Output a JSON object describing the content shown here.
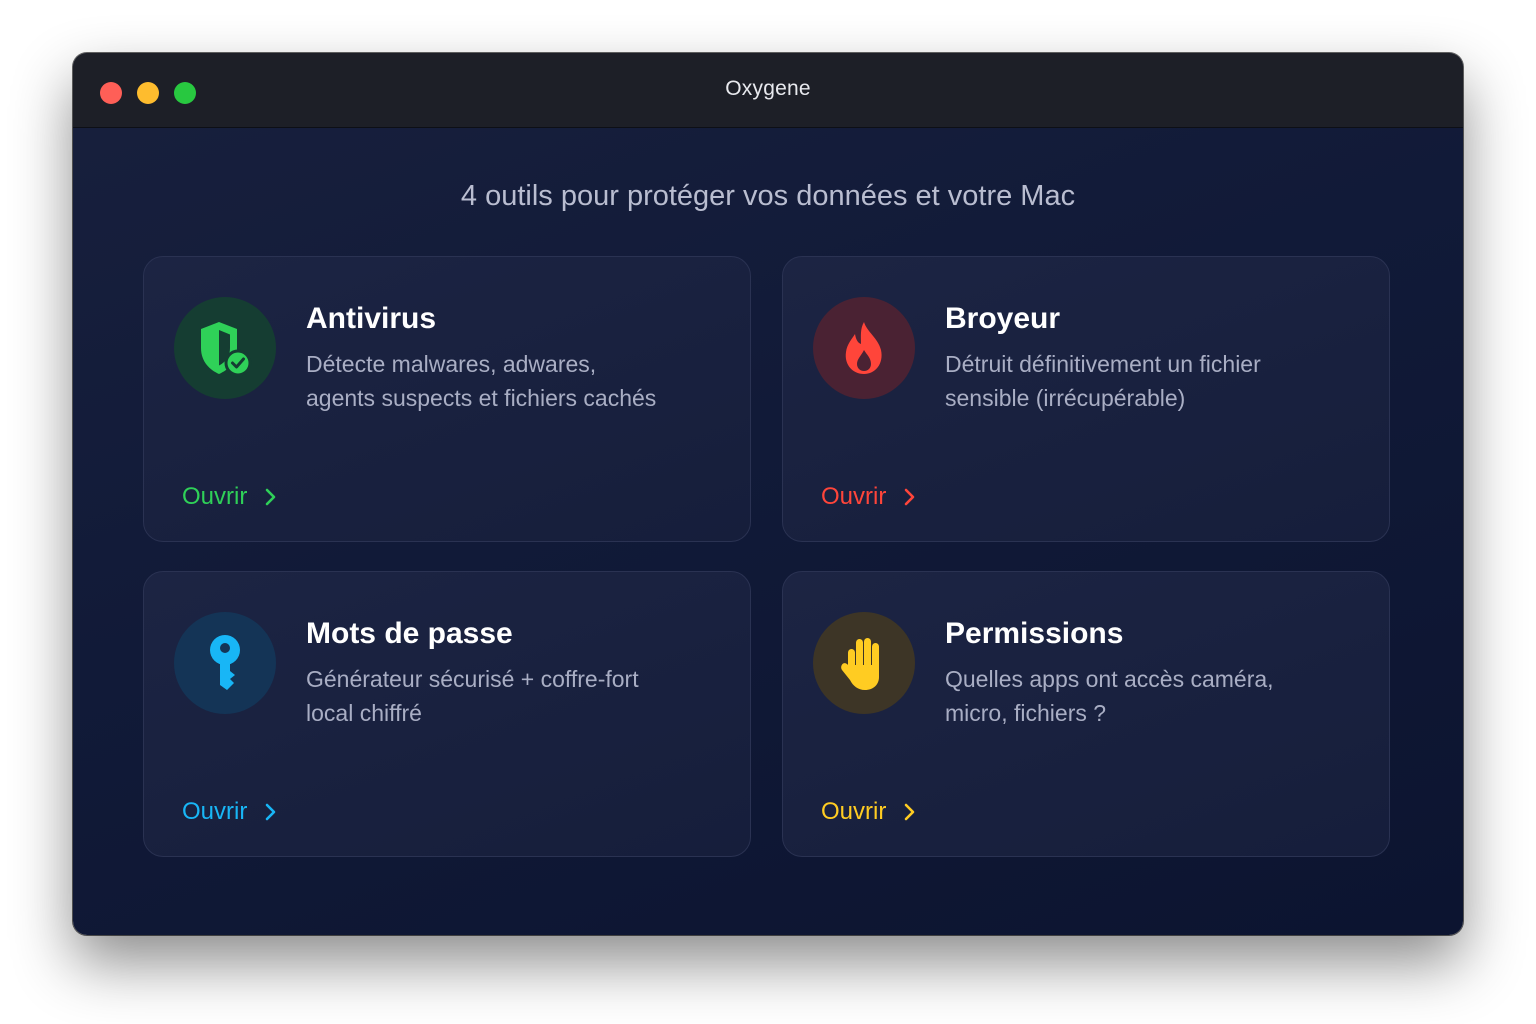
{
  "window": {
    "title": "Oxygene"
  },
  "headline": "4 outils pour protéger vos données et votre Mac",
  "colors": {
    "green": "#2fd158",
    "red": "#ff453a",
    "blue": "#18b6f6",
    "yellow": "#ffcc22"
  },
  "cards": [
    {
      "title": "Antivirus",
      "desc_line1": "Détecte malwares, adwares,",
      "desc_line2": "agents suspects et fichiers cachés",
      "link": "Ouvrir",
      "icon": "shield-check-icon"
    },
    {
      "title": "Broyeur",
      "desc_line1": "Détruit définitivement un fichier",
      "desc_line2": "sensible (irrécupérable)",
      "link": "Ouvrir",
      "icon": "flame-icon"
    },
    {
      "title": "Mots de passe",
      "desc_line1": "Générateur sécurisé + coffre-fort",
      "desc_line2": "local chiffré",
      "link": "Ouvrir",
      "icon": "key-icon"
    },
    {
      "title": "Permissions",
      "desc_line1": "Quelles apps ont accès caméra,",
      "desc_line2": "micro, fichiers ?",
      "link": "Ouvrir",
      "icon": "raised-hand-icon"
    }
  ]
}
